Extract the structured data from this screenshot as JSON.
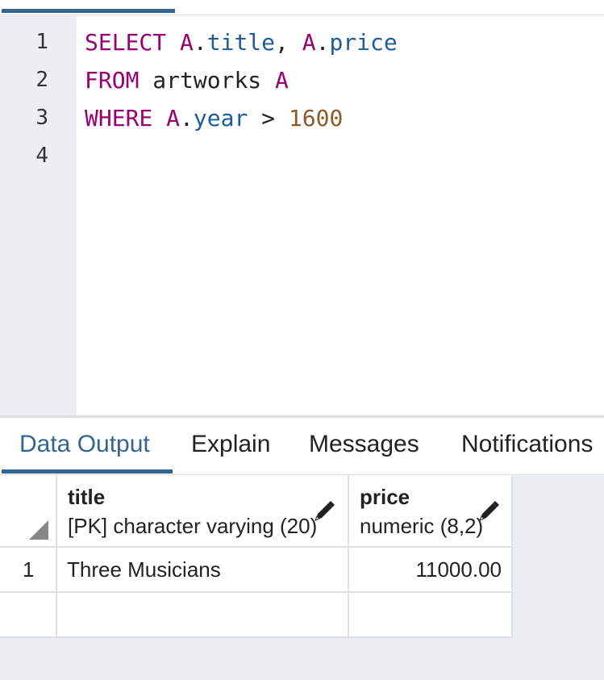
{
  "editor": {
    "lines": [
      {
        "number": "1",
        "tokens": [
          {
            "text": "SELECT",
            "class": "kw"
          },
          {
            "text": " ",
            "class": "op"
          },
          {
            "text": "A",
            "class": "alias"
          },
          {
            "text": ".",
            "class": "op"
          },
          {
            "text": "title",
            "class": "prop"
          },
          {
            "text": ", ",
            "class": "op"
          },
          {
            "text": "A",
            "class": "alias"
          },
          {
            "text": ".",
            "class": "op"
          },
          {
            "text": "price",
            "class": "prop"
          }
        ]
      },
      {
        "number": "2",
        "tokens": [
          {
            "text": "FROM",
            "class": "kw"
          },
          {
            "text": " artworks ",
            "class": "op"
          },
          {
            "text": "A",
            "class": "alias"
          }
        ]
      },
      {
        "number": "3",
        "tokens": [
          {
            "text": "WHERE",
            "class": "kw"
          },
          {
            "text": " ",
            "class": "op"
          },
          {
            "text": "A",
            "class": "alias"
          },
          {
            "text": ".",
            "class": "op"
          },
          {
            "text": "year",
            "class": "prop"
          },
          {
            "text": " > ",
            "class": "op"
          },
          {
            "text": "1600",
            "class": "num"
          }
        ]
      },
      {
        "number": "4",
        "tokens": []
      }
    ]
  },
  "result_tabs": {
    "data_output": "Data Output",
    "explain": "Explain",
    "messages": "Messages",
    "notifications": "Notifications"
  },
  "grid": {
    "columns": [
      {
        "name": "title",
        "type": "[PK] character varying (20)"
      },
      {
        "name": "price",
        "type": "numeric (8,2)"
      }
    ],
    "rows": [
      {
        "row_number": "1",
        "title": "Three Musicians",
        "price": "11000.00"
      }
    ]
  },
  "colors": {
    "accent": "#326690",
    "keyword": "#990073",
    "identifier": "#1c5c9c",
    "number": "#8c5a2b",
    "gutter": "#ebeef3"
  }
}
